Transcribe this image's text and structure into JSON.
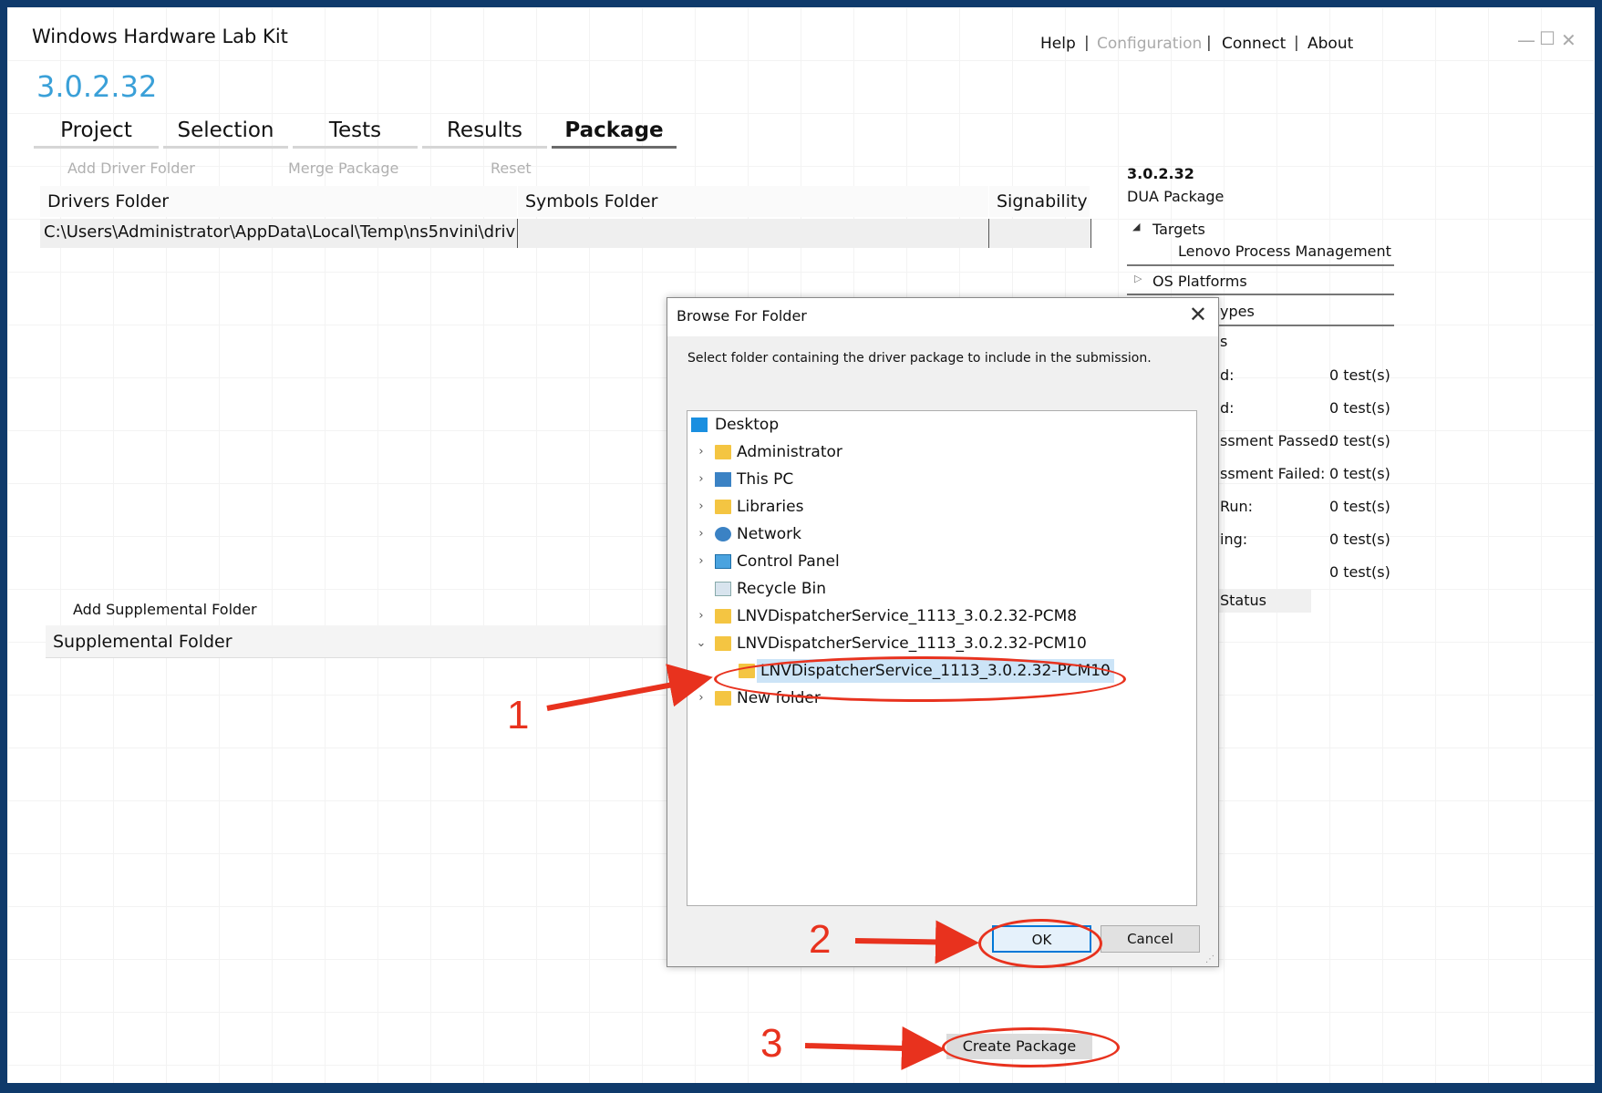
{
  "app": {
    "title": "Windows Hardware Lab Kit",
    "version": "3.0.2.32",
    "nav": {
      "help": "Help",
      "configuration": "Configuration",
      "connect": "Connect",
      "about": "About",
      "separator": "|"
    },
    "window_controls": {
      "minimize": "—",
      "maximize": "☐",
      "close": "✕"
    }
  },
  "tabs": [
    {
      "label": "Project",
      "active": false
    },
    {
      "label": "Selection",
      "active": false
    },
    {
      "label": "Tests",
      "active": false
    },
    {
      "label": "Results",
      "active": false
    },
    {
      "label": "Package",
      "active": true
    }
  ],
  "toolbar": {
    "add_driver_folder": "Add Driver Folder",
    "merge_package": "Merge Package",
    "reset": "Reset"
  },
  "drivers_table": {
    "headers": [
      "Drivers Folder",
      "Symbols Folder",
      "Signability"
    ],
    "rows": [
      {
        "drivers_folder": "C:\\Users\\Administrator\\AppData\\Local\\Temp\\ns5nvini\\driv",
        "symbols_folder": "",
        "signability": ""
      }
    ]
  },
  "right_panel": {
    "version": "3.0.2.32",
    "package_type": "DUA Package",
    "targets_label": "Targets",
    "target_item": "Lenovo Process Management",
    "os_platforms_label": "OS Platforms",
    "partial_labels": [
      "ypes",
      "s",
      "d:",
      "d:",
      "ssment Passed:",
      "ssment Failed:",
      "Run:",
      "ing:",
      "",
      "Status"
    ],
    "counts": [
      "0 test(s)",
      "0 test(s)",
      "0 test(s)",
      "0 test(s)",
      "0 test(s)",
      "0 test(s)",
      "0 test(s)"
    ]
  },
  "supplemental": {
    "add_label": "Add Supplemental Folder",
    "header": "Supplemental Folder"
  },
  "create_package_label": "Create Package",
  "dialog": {
    "title": "Browse For Folder",
    "close": "✕",
    "instruction": "Select folder containing the driver package to include in the submission.",
    "tree": [
      {
        "label": "Desktop",
        "icon": "desktop-icon",
        "expander": ""
      },
      {
        "label": "Administrator",
        "icon": "user-icon",
        "expander": "›"
      },
      {
        "label": "This PC",
        "icon": "pc-icon",
        "expander": "›"
      },
      {
        "label": "Libraries",
        "icon": "libraries-icon",
        "expander": "›"
      },
      {
        "label": "Network",
        "icon": "network-icon",
        "expander": "›"
      },
      {
        "label": "Control Panel",
        "icon": "control-panel-icon",
        "expander": "›"
      },
      {
        "label": "Recycle Bin",
        "icon": "recycle-bin-icon",
        "expander": ""
      },
      {
        "label": "LNVDispatcherService_1113_3.0.2.32-PCM8",
        "icon": "folder-icon",
        "expander": "›"
      },
      {
        "label": "LNVDispatcherService_1113_3.0.2.32-PCM10",
        "icon": "folder-icon",
        "expander": "⌄"
      },
      {
        "label": "LNVDispatcherService_1113_3.0.2.32-PCM10",
        "icon": "folder-icon",
        "expander": "",
        "selected": true
      },
      {
        "label": "New folder",
        "icon": "folder-icon",
        "expander": "›"
      }
    ],
    "ok_label": "OK",
    "cancel_label": "Cancel"
  },
  "annotations": {
    "step1": "1",
    "step2": "2",
    "step3": "3",
    "color": "#e8321e"
  }
}
